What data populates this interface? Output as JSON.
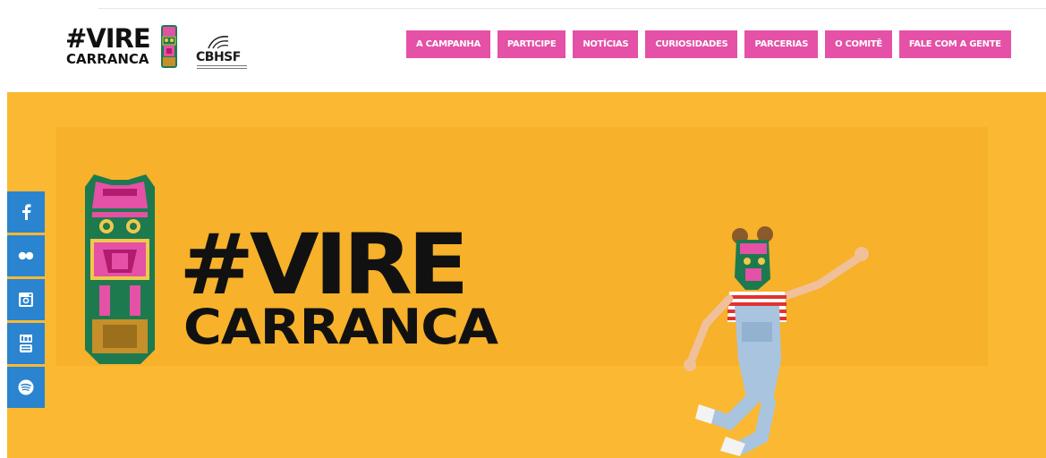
{
  "brand": {
    "line1": "#VIRE",
    "line2": "CARRANCA",
    "partner": "CBHSF"
  },
  "nav": {
    "items": [
      {
        "label": "A CAMPANHA"
      },
      {
        "label": "PARTICIPE"
      },
      {
        "label": "NOTÍCIAS"
      },
      {
        "label": "CURIOSIDADES"
      },
      {
        "label": "PARCERIAS"
      },
      {
        "label": "O COMITÊ"
      },
      {
        "label": "FALE COM A GENTE"
      }
    ]
  },
  "hero": {
    "title_line1": "#VIRE",
    "title_line2": "CARRANCA"
  },
  "social": {
    "items": [
      {
        "icon": "facebook-icon"
      },
      {
        "icon": "flickr-icon"
      },
      {
        "icon": "instagram-icon"
      },
      {
        "icon": "youtube-icon"
      },
      {
        "icon": "spotify-icon"
      }
    ]
  },
  "colors": {
    "accent_pink": "#e451a6",
    "hero_yellow": "#fbb832",
    "social_blue": "#2a84cf",
    "totem_green": "#1d7a4f"
  }
}
